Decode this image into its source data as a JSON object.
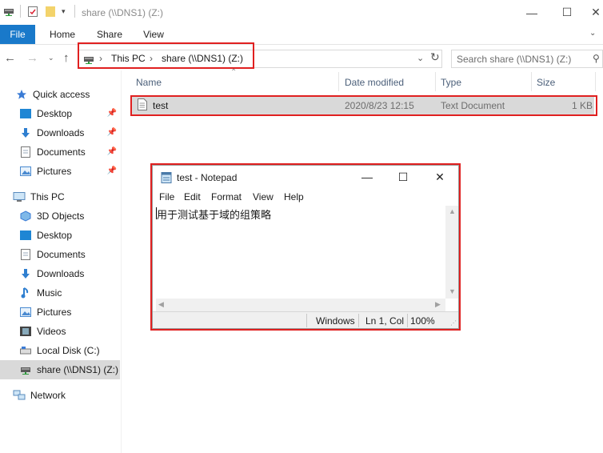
{
  "window": {
    "title": "share (\\\\DNS1) (Z:)",
    "minimize": "—",
    "maximize": "☐",
    "close": "✕"
  },
  "ribbon": {
    "tabs": [
      "File",
      "Home",
      "Share",
      "View"
    ]
  },
  "address": {
    "crumbs": [
      "This PC",
      "share (\\\\DNS1) (Z:)"
    ],
    "separator": "›"
  },
  "search": {
    "placeholder": "Search share (\\\\DNS1) (Z:)"
  },
  "nav": {
    "quick_access": "Quick access",
    "quick_items": [
      "Desktop",
      "Downloads",
      "Documents",
      "Pictures"
    ],
    "this_pc": "This PC",
    "pc_items": [
      "3D Objects",
      "Desktop",
      "Documents",
      "Downloads",
      "Music",
      "Pictures",
      "Videos",
      "Local Disk (C:)",
      "share (\\\\DNS1) (Z:)"
    ],
    "network": "Network"
  },
  "files": {
    "columns": [
      "Name",
      "Date modified",
      "Type",
      "Size"
    ],
    "rows": [
      {
        "name": "test",
        "date": "2020/8/23 12:15",
        "type": "Text Document",
        "size": "1 KB"
      }
    ]
  },
  "notepad": {
    "title": "test - Notepad",
    "menu": [
      "File",
      "Edit",
      "Format",
      "View",
      "Help"
    ],
    "content": "用于测试基于域的组策略",
    "status": {
      "encoding": "Windows",
      "position": "Ln 1, Col",
      "zoom": "100%"
    }
  },
  "colors": {
    "accent": "#1979ca",
    "highlight_box": "#e02020",
    "selected_row": "#d9d9d9"
  }
}
